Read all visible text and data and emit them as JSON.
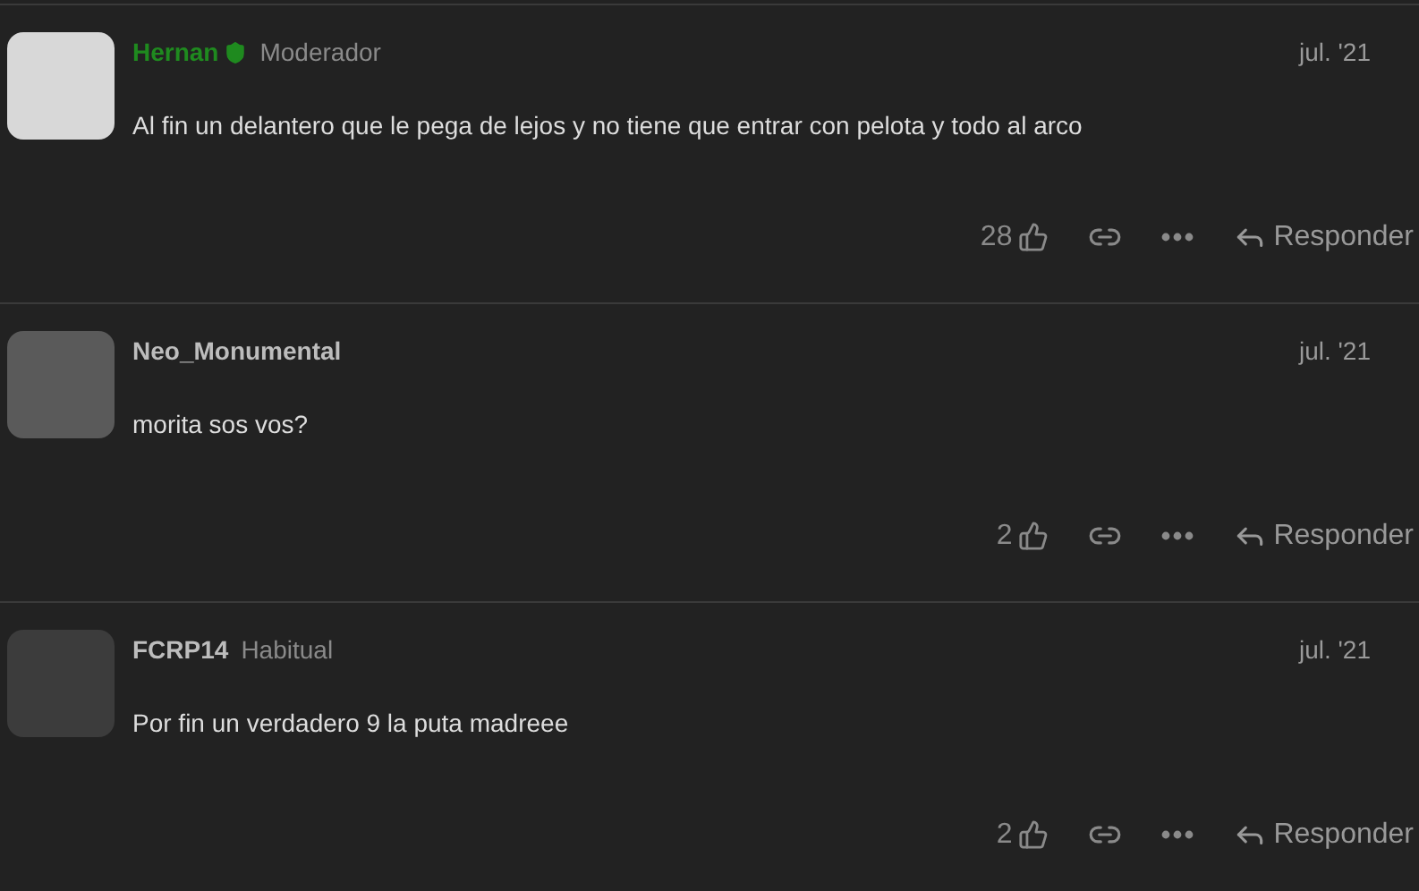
{
  "posts": [
    {
      "username": "Hernan",
      "moderator": true,
      "title": "Moderador",
      "date": "jul. '21",
      "body": "Al fin un delantero que le pega de lejos y no tiene que entrar con pelota y todo al arco",
      "likes": "28",
      "reply_label": "Responder"
    },
    {
      "username": "Neo_Monumental",
      "moderator": false,
      "date": "jul. '21",
      "body": "morita sos vos?",
      "likes": "2",
      "reply_label": "Responder"
    },
    {
      "username": "FCRP14",
      "moderator": false,
      "title": "Habitual",
      "date": "jul. '21",
      "body": "Por fin un verdadero 9 la puta madreee",
      "likes": "2",
      "reply_label": "Responder"
    }
  ]
}
